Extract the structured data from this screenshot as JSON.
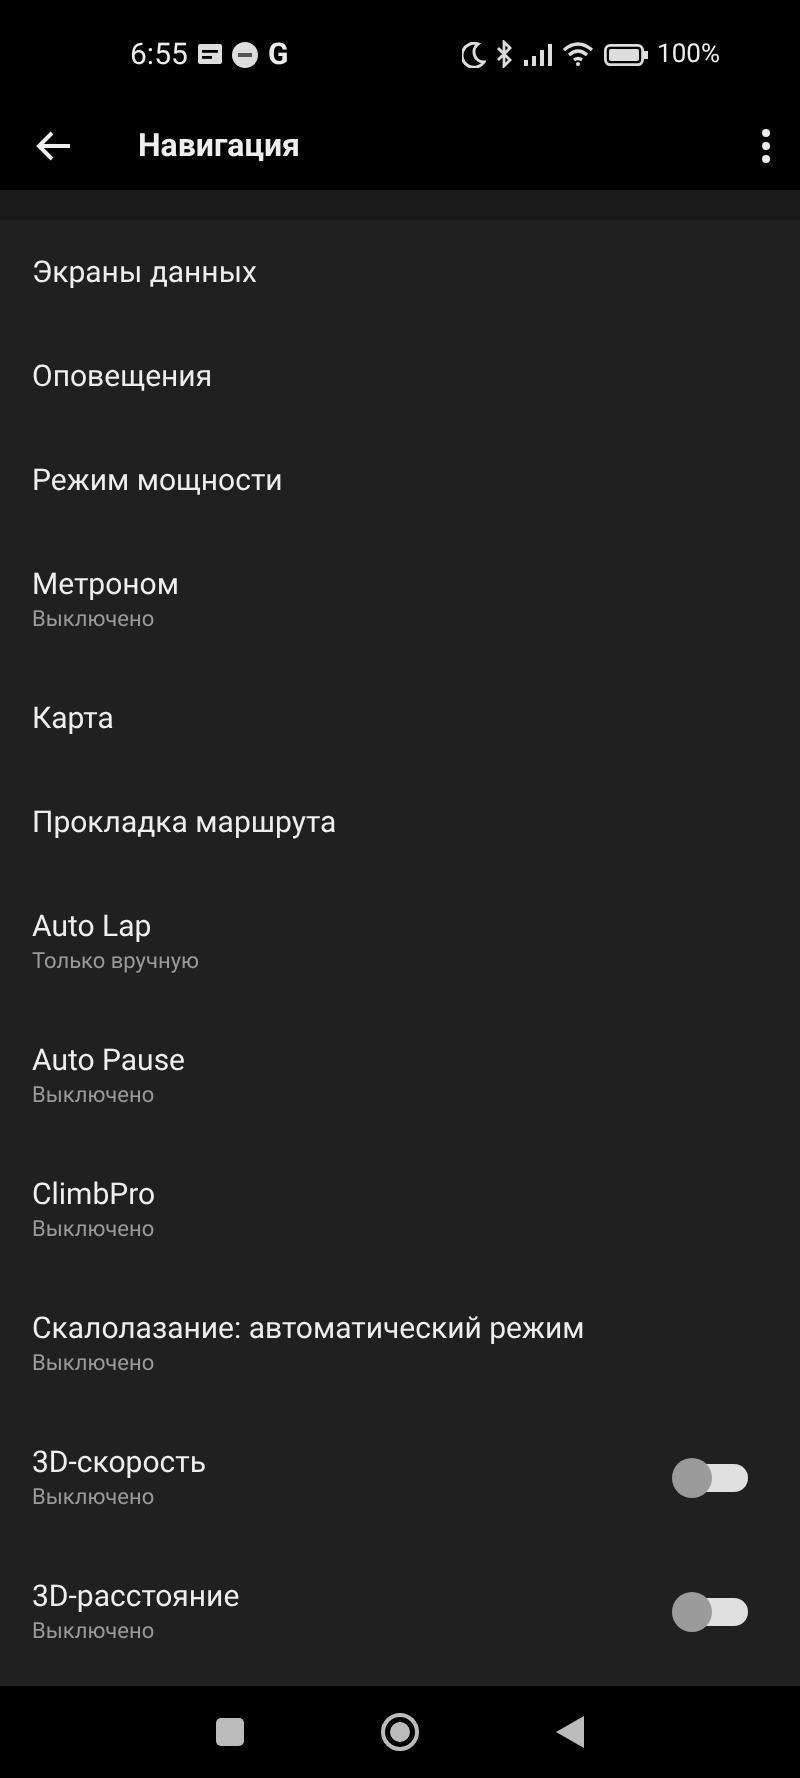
{
  "status_bar": {
    "time": "6:55",
    "app_letter": "G",
    "battery_text": "100%"
  },
  "app_bar": {
    "title": "Навигация"
  },
  "items": [
    {
      "kind": "plain",
      "title": "Экраны данных"
    },
    {
      "kind": "plain",
      "title": "Оповещения"
    },
    {
      "kind": "plain",
      "title": "Режим мощности"
    },
    {
      "kind": "plain",
      "title": "Метроном",
      "subtitle": "Выключено"
    },
    {
      "kind": "plain",
      "title": "Карта"
    },
    {
      "kind": "plain",
      "title": "Прокладка маршрута"
    },
    {
      "kind": "plain",
      "title": "Auto Lap",
      "subtitle": "Только вручную"
    },
    {
      "kind": "plain",
      "title": "Auto Pause",
      "subtitle": "Выключено"
    },
    {
      "kind": "plain",
      "title": "ClimbPro",
      "subtitle": "Выключено"
    },
    {
      "kind": "plain",
      "title": "Скалолазание: автоматический режим",
      "subtitle": "Выключено"
    },
    {
      "kind": "toggle",
      "title": "3D-скорость",
      "subtitle": "Выключено",
      "on": false
    },
    {
      "kind": "toggle",
      "title": "3D-расстояние",
      "subtitle": "Выключено",
      "on": false
    }
  ]
}
